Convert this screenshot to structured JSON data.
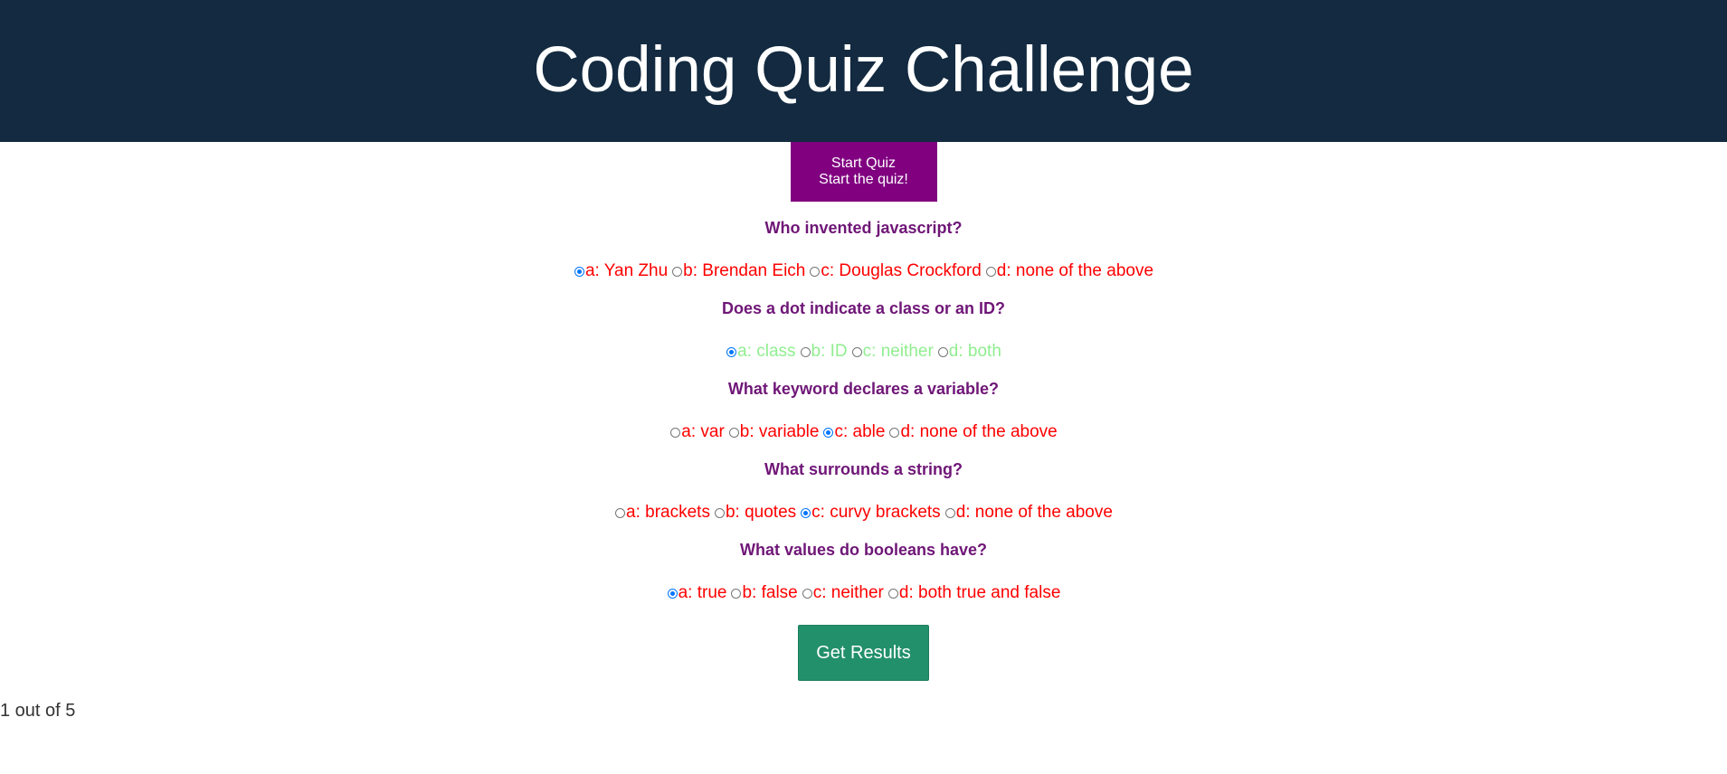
{
  "header": {
    "title": "Coding Quiz Challenge"
  },
  "start_button": {
    "line1": "Start Quiz",
    "line2": "Start the quiz!"
  },
  "questions": [
    {
      "text": "Who invented javascript?",
      "color": "#ff0000",
      "options": [
        "a: Yan Zhu",
        "b: Brendan Eich",
        "c: Douglas Crockford",
        "d: none of the above"
      ],
      "selected": 0
    },
    {
      "text": "Does a dot indicate a class or an ID?",
      "color": "#90ee90",
      "options": [
        "a: class",
        "b: ID",
        "c: neither",
        "d: both"
      ],
      "selected": 0
    },
    {
      "text": "What keyword declares a variable?",
      "color": "#ff0000",
      "options": [
        "a: var",
        "b: variable",
        "c: able",
        "d: none of the above"
      ],
      "selected": 2
    },
    {
      "text": "What surrounds a string?",
      "color": "#ff0000",
      "options": [
        "a: brackets",
        "b: quotes",
        "c: curvy brackets",
        "d: none of the above"
      ],
      "selected": 2
    },
    {
      "text": "What values do booleans have?",
      "color": "#ff0000",
      "options": [
        "a: true",
        "b: false",
        "c: neither",
        "d: both true and false"
      ],
      "selected": 0
    }
  ],
  "results_button": {
    "label": "Get Results"
  },
  "score": {
    "text": "1 out of 5"
  },
  "colors": {
    "header_bg": "#132a40",
    "start_button_bg": "#800080",
    "question_text": "#6f1677",
    "results_button_bg": "#22906b",
    "radio_checked": "#0075ff"
  }
}
